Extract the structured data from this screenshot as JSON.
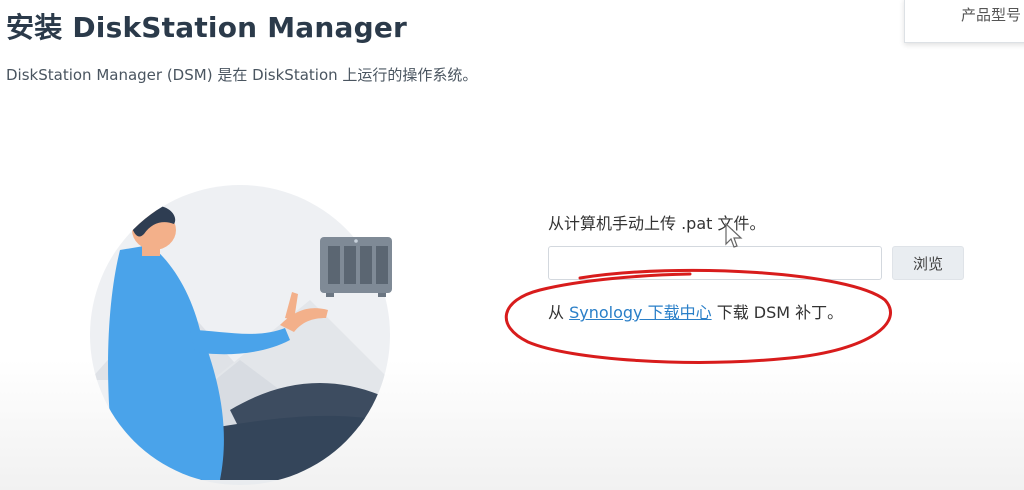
{
  "header": {
    "title": "安装 DiskStation Manager",
    "subtitle": "DiskStation Manager (DSM) 是在 DiskStation 上运行的操作系统。"
  },
  "model_panel": {
    "label": "产品型号"
  },
  "upload": {
    "label": "从计算机手动上传 .pat 文件。",
    "file_value": "",
    "browse_label": "浏览"
  },
  "download": {
    "prefix": "从 ",
    "link_text": "Synology 下载中心",
    "suffix": "下载 DSM 补丁。"
  },
  "icons": [
    "nas-device-icon",
    "person-illustration",
    "mouse-cursor-icon"
  ],
  "colors": {
    "link": "#2a7fc8",
    "annotation": "#d81c1c",
    "title": "#2b3a4a",
    "button_bg": "#e9edf1",
    "shirt": "#4aa3ea",
    "pants": "#3a4a5e"
  }
}
